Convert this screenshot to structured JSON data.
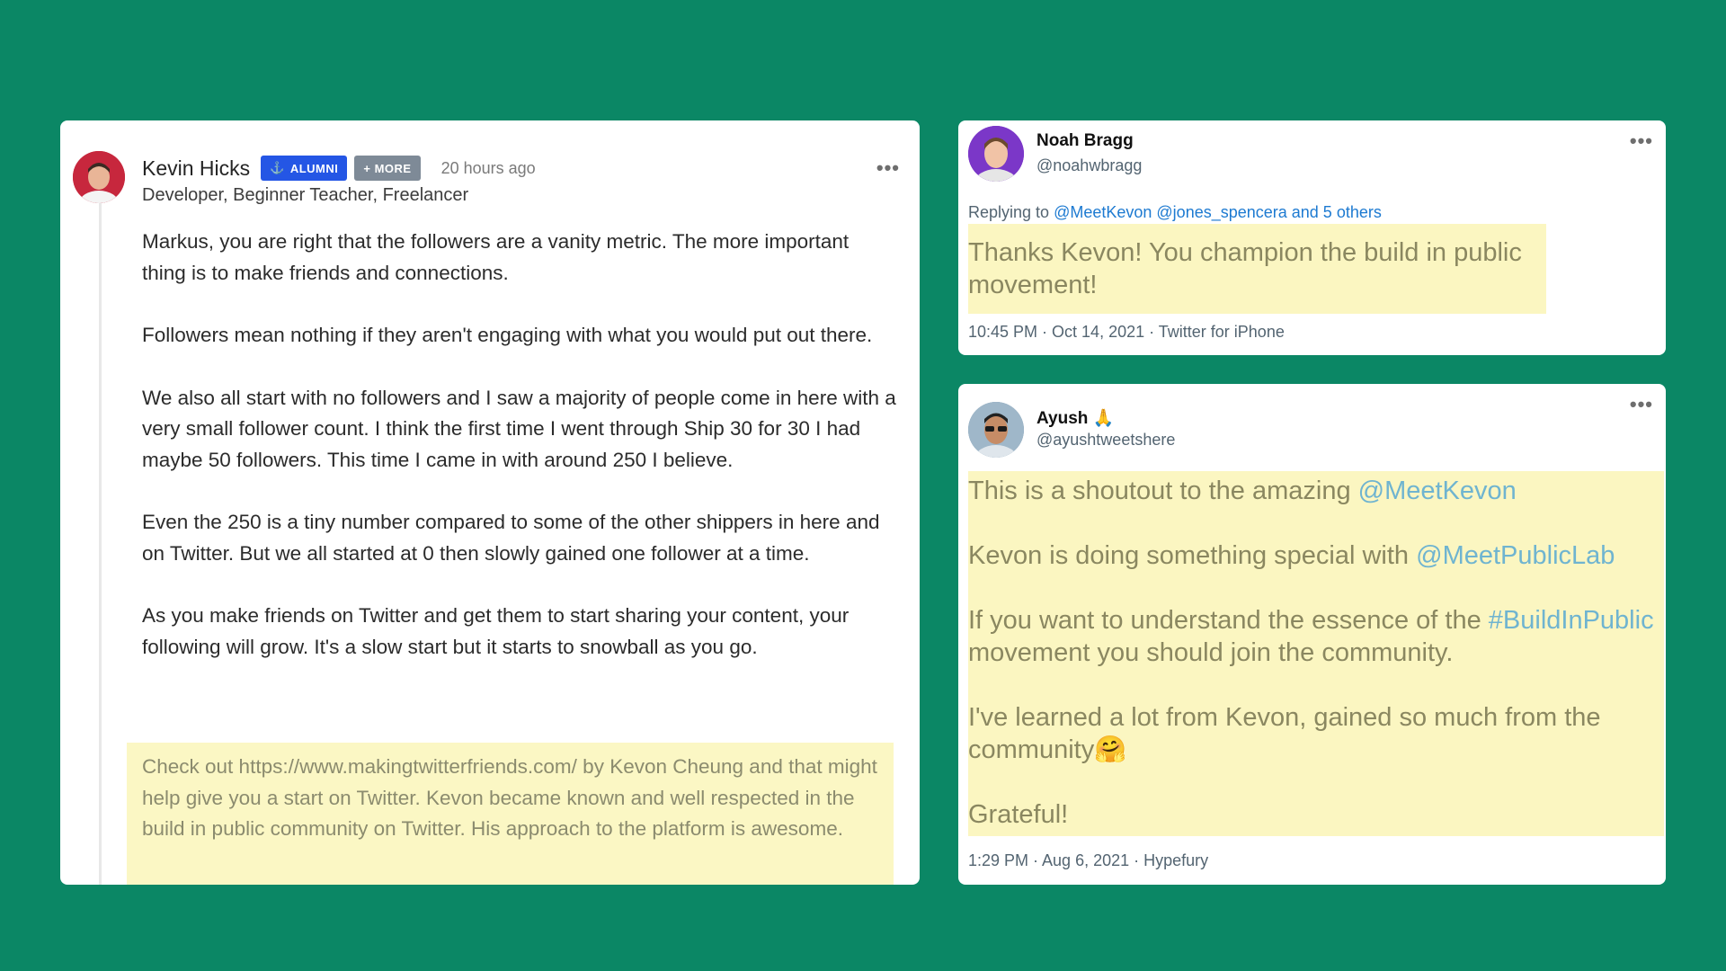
{
  "comment": {
    "author": "Kevin Hicks",
    "badge_alumni": "ALUMNI",
    "badge_more": "+ MORE",
    "time_ago": "20 hours ago",
    "subtitle": "Developer, Beginner Teacher, Freelancer",
    "paragraphs": [
      "Markus, you are right that the followers are a vanity metric. The more important thing is to make friends and connections.",
      "Followers mean nothing if they aren't engaging with what you would put out there.",
      "We also all start with no followers and I saw a majority of people come in here with a very small follower count. I think the first time I went through Ship 30 for 30 I had maybe 50 followers. This time I came in with around 250 I believe.",
      "Even the 250 is a tiny number compared to some of the other shippers in here and on Twitter. But we all started at 0 then slowly gained one follower at a time.",
      "As you make friends on Twitter and get them to start sharing your content, your following will grow. It's a slow start but it starts to snowball as you go."
    ],
    "highlight": "Check out https://www.makingtwitterfriends.com/ by Kevon Cheung and that might help give you a start on Twitter. Kevon became known and well respected in the build in public community on Twitter. His approach to the platform is awesome.",
    "more_label": "•••",
    "badge_icon": "anchor-icon"
  },
  "tweet1": {
    "name": "Noah Bragg",
    "handle": "@noahwbragg",
    "replying_prefix": "Replying to",
    "replying_mentions": "@MeetKevon @jones_spencera and 5 others",
    "text": "Thanks Kevon! You champion the build in public movement!",
    "meta": "10:45 PM · Oct 14, 2021 · Twitter for iPhone",
    "more_label": "•••"
  },
  "tweet2": {
    "name": "Ayush",
    "name_emoji": "🙏",
    "handle": "@ayushtweetshere",
    "line1_text": "This is a shoutout to the amazing",
    "line1_mention": "@MeetKevon",
    "line2_text": "Kevon is doing something special with",
    "line2_mention": "@MeetPublicLab",
    "line3_text": "If you want to understand the essence of the",
    "line3_hashtag": "#BuildInPublic",
    "line3_rest": "movement you should join the community.",
    "line4_text": "I've learned a lot from Kevon, gained so much from the community",
    "line4_emoji": "🤗",
    "line5_text": "Grateful!",
    "meta": "1:29 PM · Aug 6, 2021 · Hypefury",
    "more_label": "•••"
  },
  "colors": {
    "background": "#0b8765",
    "highlight": "#fbf6c1",
    "alumni_badge": "#2456e5",
    "more_badge": "#7e8a97",
    "mention": "#1d7ad1"
  }
}
